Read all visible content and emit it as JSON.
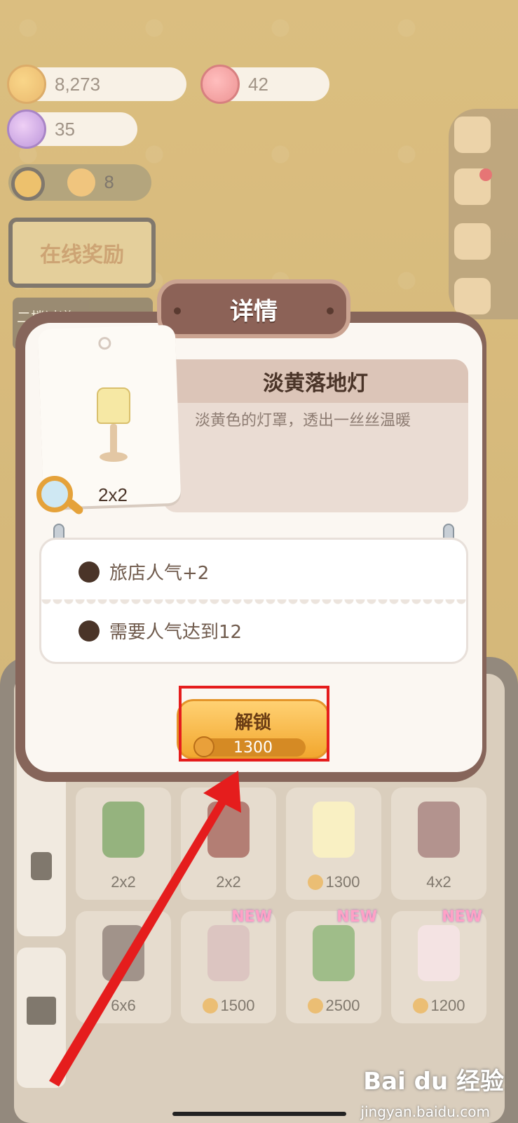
{
  "resources": {
    "cookies": "8,273",
    "jam": "42",
    "candy": "35"
  },
  "level": {
    "gingerbread_count": "8"
  },
  "online_reward_label": "在线奖励",
  "notice_text": "二楼过道",
  "modal": {
    "title": "详情",
    "item_name": "淡黄落地灯",
    "item_description": "淡黄色的灯罩，透出一丝丝温暖",
    "item_size": "2x2",
    "perks": [
      "旅店人气+2",
      "需要人气达到12"
    ],
    "unlock_label": "解锁",
    "unlock_cost": "1300"
  },
  "shop_items": [
    {
      "label": "2x2",
      "coin": false,
      "new": false,
      "color": "#5c8a3a"
    },
    {
      "label": "2x2",
      "coin": false,
      "new": false,
      "color": "#8a3a2a"
    },
    {
      "label": "1300",
      "coin": true,
      "new": false,
      "color": "#f6e8a4"
    },
    {
      "label": "4x2",
      "coin": false,
      "new": false,
      "color": "#8b5a52"
    },
    {
      "label": "6x6",
      "coin": false,
      "new": false,
      "color": "#6f5a4c"
    },
    {
      "label": "1500",
      "coin": true,
      "new": true,
      "color": "#c9a6a0"
    },
    {
      "label": "2500",
      "coin": true,
      "new": true,
      "color": "#6c9a4a"
    },
    {
      "label": "1200",
      "coin": true,
      "new": true,
      "color": "#eed4d4"
    }
  ],
  "new_badge": "NEW",
  "watermark": {
    "brand": "Bai du 经验",
    "url": "jingyan.baidu.com"
  },
  "colors": {
    "highlight": "#e51d1d",
    "accent": "#f2a72e"
  }
}
